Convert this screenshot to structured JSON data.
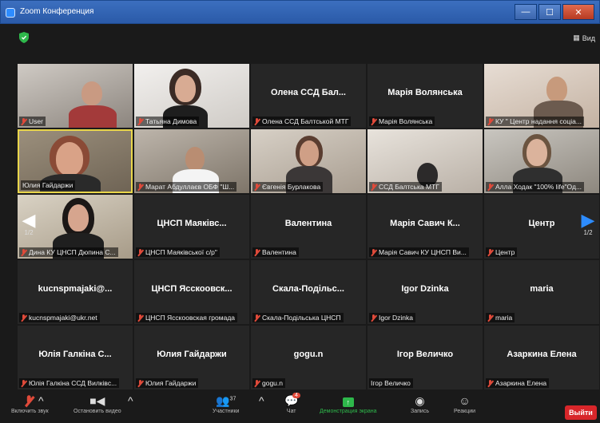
{
  "window": {
    "title": "Zoom Конференция"
  },
  "view_label": "Вид",
  "pager": {
    "left_page": "1/2",
    "right_page": "1/2"
  },
  "tiles": [
    {
      "label": "User",
      "type": "video",
      "muted": true
    },
    {
      "label": "Татьяна Димова",
      "type": "video",
      "muted": true
    },
    {
      "big": "Олена ССД Бал...",
      "label": "Олена ССД Балтськой МТГ",
      "type": "name",
      "muted": true
    },
    {
      "big": "Марія Волянська",
      "label": "Марія Волянська",
      "type": "name",
      "muted": true
    },
    {
      "label": "КУ \" Центр надання соціа...",
      "type": "video",
      "muted": true
    },
    {
      "label": "Юлия Гайдаржи",
      "type": "video",
      "muted": false,
      "active": true
    },
    {
      "label": "Марат Абдуллаєв ОБФ \"Ш...",
      "type": "video",
      "muted": true
    },
    {
      "label": "Євгенія Бурлакова",
      "type": "video",
      "muted": true
    },
    {
      "label": "ССД Балтська МТГ",
      "type": "video",
      "muted": true
    },
    {
      "label": "Алла Ходак \"100% life\"Од...",
      "type": "video",
      "muted": true
    },
    {
      "label": "Дина КУ ЦНСП Дюпина С...",
      "type": "video",
      "muted": true
    },
    {
      "big": "ЦНСП Маяківс...",
      "label": "ЦНСП Маяківської с/р\"",
      "type": "name",
      "muted": true
    },
    {
      "big": "Валентина",
      "label": "Валентина",
      "type": "name",
      "muted": true
    },
    {
      "big": "Марія Савич К...",
      "label": "Марія Савич КУ ЦНСП Ви...",
      "type": "name",
      "muted": true
    },
    {
      "big": "Центр",
      "label": "Центр",
      "type": "name",
      "muted": true
    },
    {
      "big": "kucnspmajaki@...",
      "label": "kucnspmajaki@ukr.net",
      "type": "name",
      "muted": true
    },
    {
      "big": "ЦНСП Ясскоовск...",
      "label": "ЦНСП Ясскоовская громада",
      "type": "name",
      "muted": true
    },
    {
      "big": "Скала-Подільс...",
      "label": "Скала-Подільська ЦНСП",
      "type": "name",
      "muted": true
    },
    {
      "big": "Igor Dzinka",
      "label": "Igor Dzinka",
      "type": "name",
      "muted": true
    },
    {
      "big": "maria",
      "label": "maria",
      "type": "name",
      "muted": true
    },
    {
      "big": "Юлія Галкіна С...",
      "label": "Юлія Галкіна ССД Вилківс...",
      "type": "name",
      "muted": true
    },
    {
      "big": "Юлия Гайдаржи",
      "label": "Юлия Гайдаржи",
      "type": "name",
      "muted": true
    },
    {
      "big": "gogu.n",
      "label": "gogu.n",
      "type": "name",
      "muted": true
    },
    {
      "big": "Ігор Величко",
      "label": "Ігор Величко",
      "type": "name",
      "muted": false
    },
    {
      "big": "Азаркина Елена",
      "label": "Азаркина Елена",
      "type": "name",
      "muted": true
    }
  ],
  "toolbar": {
    "audio_label": "Включить звук",
    "video_label": "Остановить видео",
    "participants_label": "Участники",
    "participants_count": "37",
    "chat_label": "Чат",
    "chat_badge": "4",
    "share_label": "Демонстрация экрана",
    "record_label": "Запись",
    "reactions_label": "Реакции",
    "exit_label": "Выйти"
  }
}
